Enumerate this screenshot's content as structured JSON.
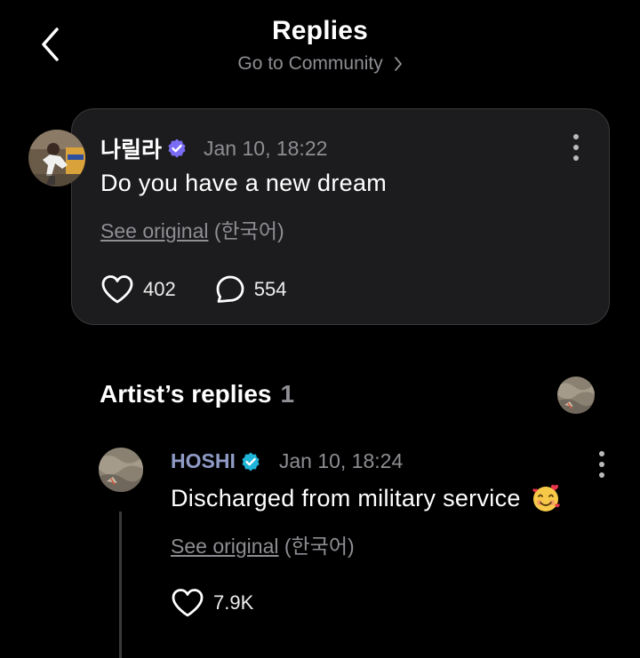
{
  "header": {
    "title": "Replies",
    "community_link": "Go to Community"
  },
  "post": {
    "author": "나릴라",
    "time": "Jan 10, 18:22",
    "text": "Do you have a new dream",
    "see_original": "See original",
    "language": "(한국어)",
    "likes": "402",
    "comments": "554"
  },
  "artist_section": {
    "title": "Artist’s replies",
    "count": "1"
  },
  "reply": {
    "author": "HOSHI",
    "time": "Jan 10, 18:24",
    "text": "Discharged from military service",
    "see_original": "See original",
    "language": "(한국어)",
    "likes": "7.9K"
  },
  "icons": {
    "back": "chevron-left-icon",
    "community_chevron": "chevron-right-icon",
    "verified": "verified-badge-icon",
    "more": "more-vertical-icon",
    "like": "heart-icon",
    "comment": "comment-bubble-icon",
    "emoji": "smiling-face-with-hearts-emoji"
  },
  "colors": {
    "background": "#000000",
    "card": "#1c1c1e",
    "muted": "#8e8e93",
    "verified_purple": "#7b6cf6",
    "verified_teal": "#1fb5d8",
    "artist_name": "#8f9bc6"
  }
}
